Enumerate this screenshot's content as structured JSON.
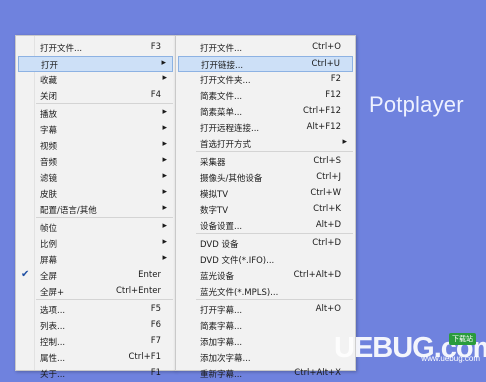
{
  "brand": "Potplayer",
  "left_menu": [
    {
      "label": "打开文件...",
      "key": "F3"
    },
    {
      "label": "打开",
      "arrow": true,
      "highlight": true
    },
    {
      "label": "收藏",
      "arrow": true
    },
    {
      "label": "关闭",
      "key": "F4"
    },
    {
      "label": "播放",
      "arrow": true
    },
    {
      "label": "字幕",
      "arrow": true
    },
    {
      "label": "视频",
      "arrow": true
    },
    {
      "label": "音频",
      "arrow": true
    },
    {
      "label": "滤镜",
      "arrow": true
    },
    {
      "label": "皮肤",
      "arrow": true
    },
    {
      "label": "配置/语言/其他",
      "arrow": true
    },
    {
      "label": "帧位",
      "arrow": true
    },
    {
      "label": "比例",
      "arrow": true
    },
    {
      "label": "屏幕",
      "arrow": true
    },
    {
      "label": "全屏",
      "key": "Enter",
      "checked": true
    },
    {
      "label": "全屏+",
      "key": "Ctrl+Enter"
    },
    {
      "label": "选项...",
      "key": "F5"
    },
    {
      "label": "列表...",
      "key": "F6"
    },
    {
      "label": "控制...",
      "key": "F7"
    },
    {
      "label": "属性...",
      "key": "Ctrl+F1"
    },
    {
      "label": "关于...",
      "key": "F1"
    }
  ],
  "right_menu": [
    {
      "label": "打开文件...",
      "key": "Ctrl+O"
    },
    {
      "label": "打开链接...",
      "key": "Ctrl+U",
      "highlight": true
    },
    {
      "label": "打开文件夹...",
      "key": "F2"
    },
    {
      "label": "简素文件...",
      "key": "F12"
    },
    {
      "label": "简素菜单...",
      "key": "Ctrl+F12"
    },
    {
      "label": "打开远程连接...",
      "key": "Alt+F12"
    },
    {
      "label": "首选打开方式",
      "arrow": true
    },
    {
      "label": "采集器",
      "key": "Ctrl+S"
    },
    {
      "label": "摄像头/其他设备",
      "key": "Ctrl+J"
    },
    {
      "label": "模拟TV",
      "key": "Ctrl+W"
    },
    {
      "label": "数字TV",
      "key": "Ctrl+K"
    },
    {
      "label": "设备设置...",
      "key": "Alt+D"
    },
    {
      "label": "DVD 设备",
      "key": "Ctrl+D"
    },
    {
      "label": "DVD 文件(*.IFO)..."
    },
    {
      "label": "蓝光设备",
      "key": "Ctrl+Alt+D"
    },
    {
      "label": "蓝光文件(*.MPLS)..."
    },
    {
      "label": "打开字幕...",
      "key": "Alt+O"
    },
    {
      "label": "简素字幕..."
    },
    {
      "label": "添加字幕..."
    },
    {
      "label": "添加次字幕..."
    },
    {
      "label": "重新字幕...",
      "key": "Ctrl+Alt+X"
    }
  ],
  "watermark": {
    "logo": "UEBUG.com",
    "tag": "下载站",
    "domain": "www.uebug.com"
  }
}
